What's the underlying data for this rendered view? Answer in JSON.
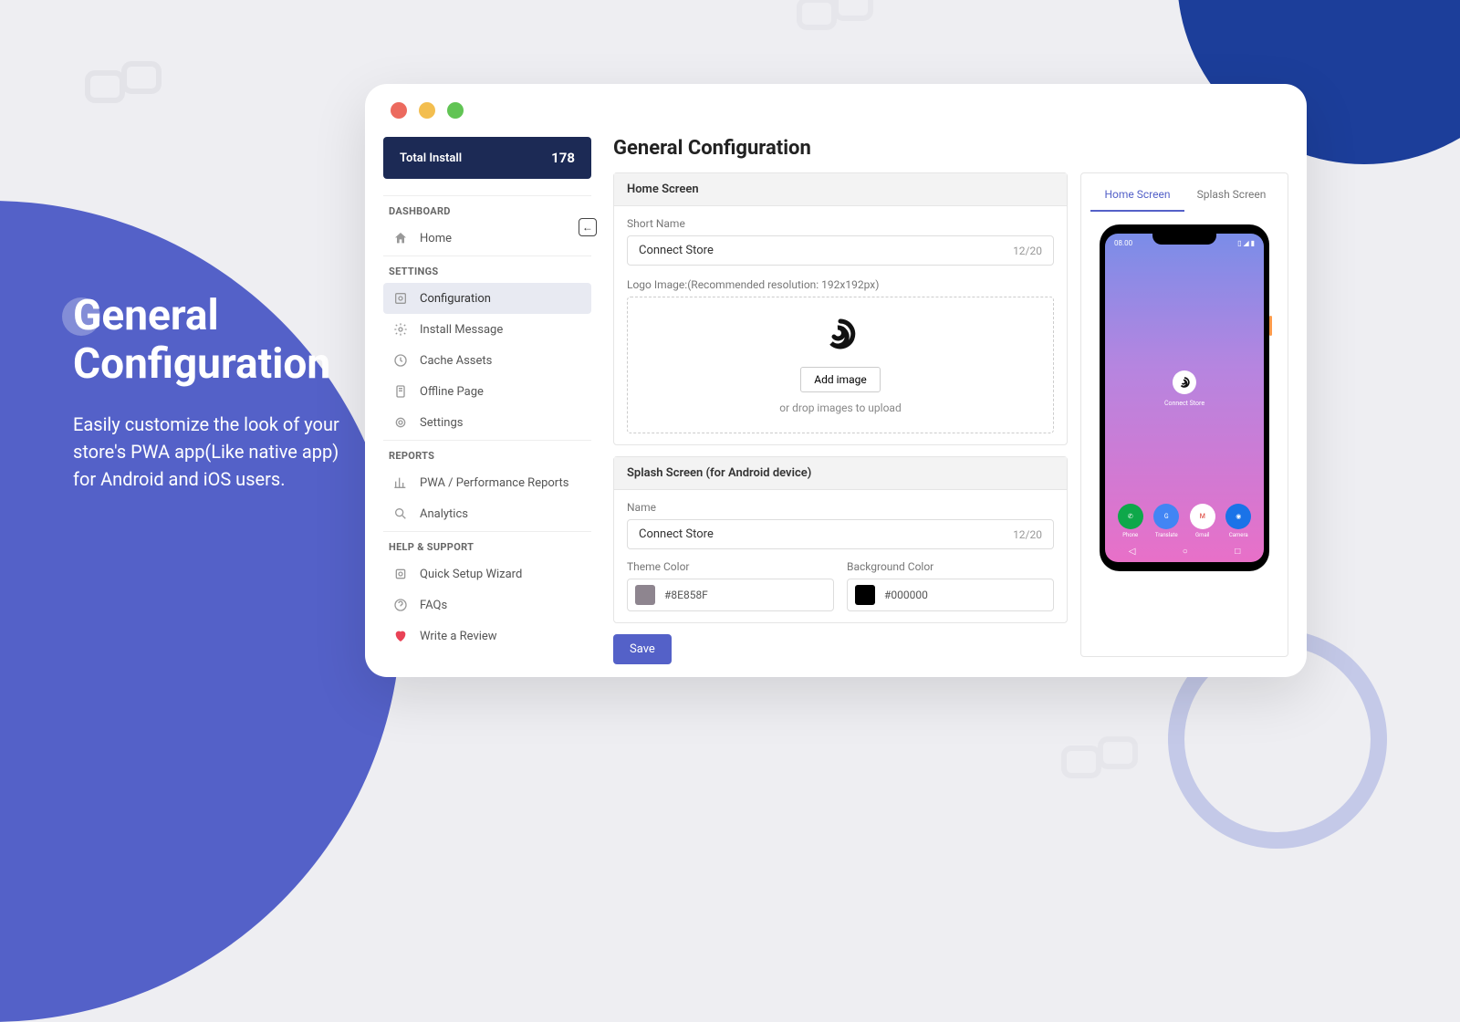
{
  "marketing": {
    "title_line1": "General",
    "title_line2": "Configuration",
    "desc": "Easily customize the look of your store's PWA app(Like native app) for Android and iOS users."
  },
  "sidebar": {
    "install_label": "Total Install",
    "install_count": "178",
    "groups": {
      "dashboard": {
        "header": "DASHBOARD",
        "home": "Home"
      },
      "settings": {
        "header": "SETTINGS",
        "configuration": "Configuration",
        "install_message": "Install Message",
        "cache_assets": "Cache Assets",
        "offline_page": "Offline Page",
        "settings": "Settings"
      },
      "reports": {
        "header": "REPORTS",
        "pwa_reports": "PWA / Performance Reports",
        "analytics": "Analytics"
      },
      "help": {
        "header": "HELP & SUPPORT",
        "setup_wizard": "Quick Setup Wizard",
        "faqs": "FAQs",
        "review": "Write a Review"
      }
    }
  },
  "page": {
    "title": "General Configuration",
    "home_screen": {
      "header": "Home Screen",
      "short_name_label": "Short Name",
      "short_name_value": "Connect Store",
      "short_name_counter": "12/20",
      "logo_label": "Logo Image:(Recommended resolution: 192x192px)",
      "add_image": "Add image",
      "drop_hint": "or drop images to upload"
    },
    "splash": {
      "header": "Splash Screen (for Android device)",
      "name_label": "Name",
      "name_value": "Connect Store",
      "name_counter": "12/20",
      "theme_label": "Theme Color",
      "theme_value": "#8E858F",
      "bg_label": "Background Color",
      "bg_value": "#000000"
    },
    "save": "Save"
  },
  "preview": {
    "tab_home": "Home Screen",
    "tab_splash": "Splash Screen",
    "time": "08.00",
    "app_name": "Connect Store",
    "icons": {
      "phone": "Phone",
      "translate": "Translate",
      "gmail": "Gmail",
      "camera": "Camera"
    }
  }
}
